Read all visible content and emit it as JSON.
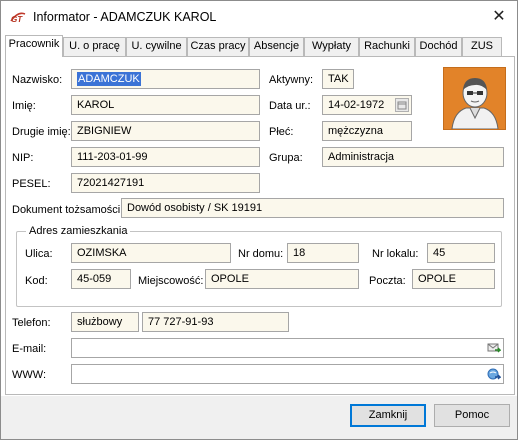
{
  "window": {
    "title": "Informator - ADAMCZUK KAROL",
    "app_icon": "GT",
    "close_glyph": "✕"
  },
  "tabs": [
    {
      "label": "Pracownik",
      "active": true
    },
    {
      "label": "U. o pracę"
    },
    {
      "label": "U. cywilne"
    },
    {
      "label": "Czas pracy"
    },
    {
      "label": "Absencje"
    },
    {
      "label": "Wypłaty"
    },
    {
      "label": "Rachunki"
    },
    {
      "label": "Dochód"
    },
    {
      "label": "ZUS"
    }
  ],
  "employee": {
    "nazwisko_label": "Nazwisko:",
    "nazwisko": "ADAMCZUK",
    "imie_label": "Imię:",
    "imie": "KAROL",
    "drugie_imie_label": "Drugie imię:",
    "drugie_imie": "ZBIGNIEW",
    "nip_label": "NIP:",
    "nip": "111-203-01-99",
    "pesel_label": "PESEL:",
    "pesel": "72021427191",
    "aktywny_label": "Aktywny:",
    "aktywny": "TAK",
    "data_ur_label": "Data ur.:",
    "data_ur": "14-02-1972",
    "plec_label": "Płeć:",
    "plec": "mężczyzna",
    "grupa_label": "Grupa:",
    "grupa": "Administracja",
    "dokument_label": "Dokument tożsamości:",
    "dokument": "Dowód osobisty / SK 19191"
  },
  "address": {
    "group_title": "Adres zamieszkania",
    "ulica_label": "Ulica:",
    "ulica": "OZIMSKA",
    "nr_domu_label": "Nr domu:",
    "nr_domu": "18",
    "nr_lokalu_label": "Nr lokalu:",
    "nr_lokalu": "45",
    "kod_label": "Kod:",
    "kod": "45-059",
    "miejscowosc_label": "Miejscowość:",
    "miejscowosc": "OPOLE",
    "poczta_label": "Poczta:",
    "poczta": "OPOLE"
  },
  "contact": {
    "telefon_label": "Telefon:",
    "telefon_type": "służbowy",
    "telefon": "77 727-91-93",
    "email_label": "E-mail:",
    "email": "",
    "www_label": "WWW:",
    "www": ""
  },
  "buttons": {
    "close": "Zamknij",
    "help": "Pomoc"
  },
  "colors": {
    "field_bg": "#fbf8ec",
    "selection": "#3b73d6",
    "photo_bg": "#e28329",
    "default_button_border": "#0078d7"
  },
  "icons": {
    "photo": "user-photo-icon",
    "date_picker": "calendar-icon",
    "email_action": "send-email-icon",
    "www_action": "open-browser-icon"
  }
}
